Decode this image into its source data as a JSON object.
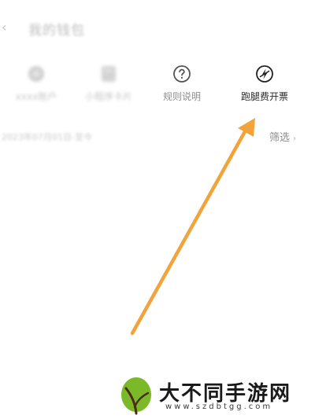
{
  "header": {
    "back_icon": "chevron-left-icon",
    "title": "我的钱包"
  },
  "shortcuts": [
    {
      "icon": "circle-icon",
      "label": "xxxx账户"
    },
    {
      "icon": "card-icon",
      "label": "小程序卡片"
    },
    {
      "icon": "question-circle-icon",
      "label": "规则说明"
    },
    {
      "icon": "no-lightning-icon",
      "label": "跑腿费开票"
    }
  ],
  "list": {
    "summary": "2023年07月01日-至今",
    "filter_label": "筛选",
    "filter_icon": "chevron-down-icon"
  },
  "annotation": {
    "arrow_color": "#f2a33a"
  },
  "watermark": {
    "brand": "大不同手游网",
    "url": "www.szdbtgg.com"
  }
}
